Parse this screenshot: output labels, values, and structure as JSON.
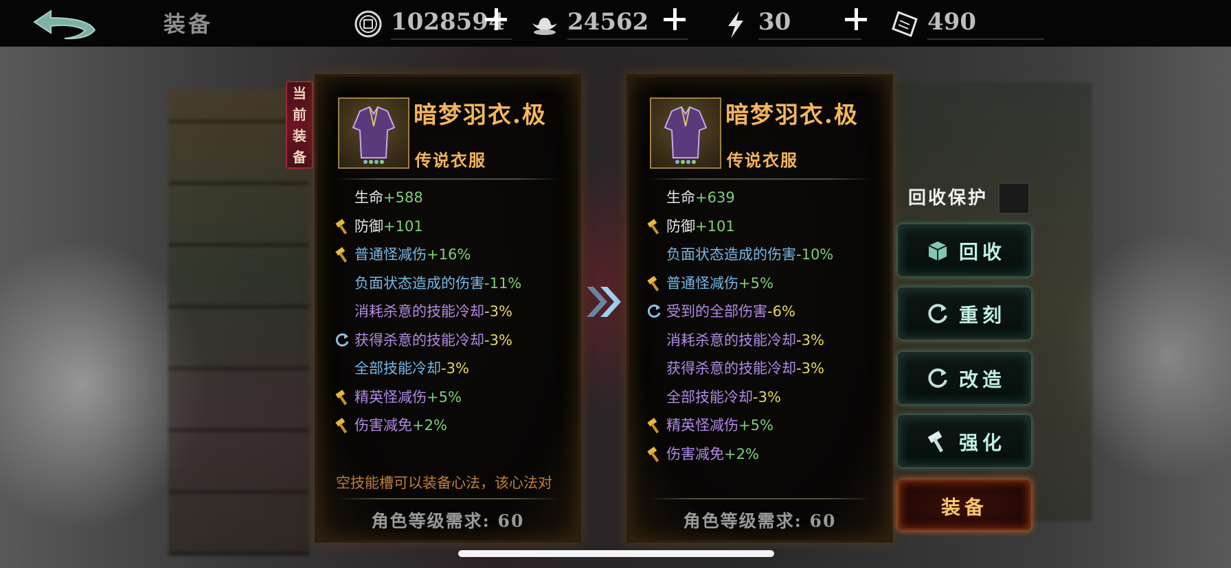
{
  "header": {
    "title": "装备",
    "currencies": [
      {
        "icon": "copper-coin-icon",
        "value": "1028594"
      },
      {
        "icon": "silver-ingot-icon",
        "value": "24562"
      },
      {
        "icon": "lightning-energy-icon",
        "value": "30"
      },
      {
        "icon": "ticket-scroll-icon",
        "value": "490"
      }
    ]
  },
  "current_tag": [
    "当",
    "前",
    "装",
    "备"
  ],
  "left_card": {
    "name": "暗梦羽衣.极",
    "type": "传说衣服",
    "stats": [
      {
        "label": "生命",
        "value": "+588",
        "label_color": "white",
        "value_color": "green",
        "icon": ""
      },
      {
        "label": "防御",
        "value": "+101",
        "label_color": "white",
        "value_color": "green",
        "icon": "hammer-icon"
      },
      {
        "label": "普通怪减伤",
        "value": "+16%",
        "label_color": "blue",
        "value_color": "green",
        "icon": "hammer-icon"
      },
      {
        "label": "负面状态造成的伤害",
        "value": "-11%",
        "label_color": "blue",
        "value_color": "green",
        "icon": ""
      },
      {
        "label": "消耗杀意的技能冷却",
        "value": "-3%",
        "label_color": "purple",
        "value_color": "yellow",
        "icon": ""
      },
      {
        "label": "获得杀意的技能冷却",
        "value": "-3%",
        "label_color": "purple",
        "value_color": "yellow",
        "icon": "refresh-icon"
      },
      {
        "label": "全部技能冷却",
        "value": "-3%",
        "label_color": "blue",
        "value_color": "yellow",
        "icon": ""
      },
      {
        "label": "精英怪减伤",
        "value": "+5%",
        "label_color": "purple",
        "value_color": "green",
        "icon": "hammer-icon"
      },
      {
        "label": "伤害减免",
        "value": "+2%",
        "label_color": "purple",
        "value_color": "green",
        "icon": "hammer-icon"
      }
    ],
    "note": "空技能槽可以装备心法，该心法对",
    "requirement": "角色等级需求: 60"
  },
  "right_card": {
    "name": "暗梦羽衣.极",
    "type": "传说衣服",
    "stats": [
      {
        "label": "生命",
        "value": "+639",
        "label_color": "white",
        "value_color": "green",
        "icon": ""
      },
      {
        "label": "防御",
        "value": "+101",
        "label_color": "white",
        "value_color": "green",
        "icon": "hammer-icon"
      },
      {
        "label": "负面状态造成的伤害",
        "value": "-10%",
        "label_color": "blue",
        "value_color": "green",
        "icon": ""
      },
      {
        "label": "普通怪减伤",
        "value": "+5%",
        "label_color": "blue",
        "value_color": "green",
        "icon": "hammer-icon"
      },
      {
        "label": "受到的全部伤害",
        "value": "-6%",
        "label_color": "purple",
        "value_color": "yellow",
        "icon": "refresh-icon"
      },
      {
        "label": "消耗杀意的技能冷却",
        "value": "-3%",
        "label_color": "purple",
        "value_color": "yellow",
        "icon": ""
      },
      {
        "label": "获得杀意的技能冷却",
        "value": "-3%",
        "label_color": "purple",
        "value_color": "yellow",
        "icon": ""
      },
      {
        "label": "全部技能冷却",
        "value": "-3%",
        "label_color": "purple",
        "value_color": "yellow",
        "icon": ""
      },
      {
        "label": "精英怪减伤",
        "value": "+5%",
        "label_color": "purple",
        "value_color": "green",
        "icon": "hammer-icon"
      },
      {
        "label": "伤害减免",
        "value": "+2%",
        "label_color": "purple",
        "value_color": "green",
        "icon": "hammer-icon"
      }
    ],
    "requirement": "角色等级需求: 60"
  },
  "actions": {
    "protect_label": "回收保护",
    "recycle": "回收",
    "reforge": "重刻",
    "modify": "改造",
    "enhance": "强化",
    "equip": "装备"
  },
  "colors": {
    "gold": "#f5b65a",
    "green": "#7fd07a",
    "blue": "#78b8e6",
    "purple": "#b38ae6",
    "yellow": "#e8d85a"
  }
}
